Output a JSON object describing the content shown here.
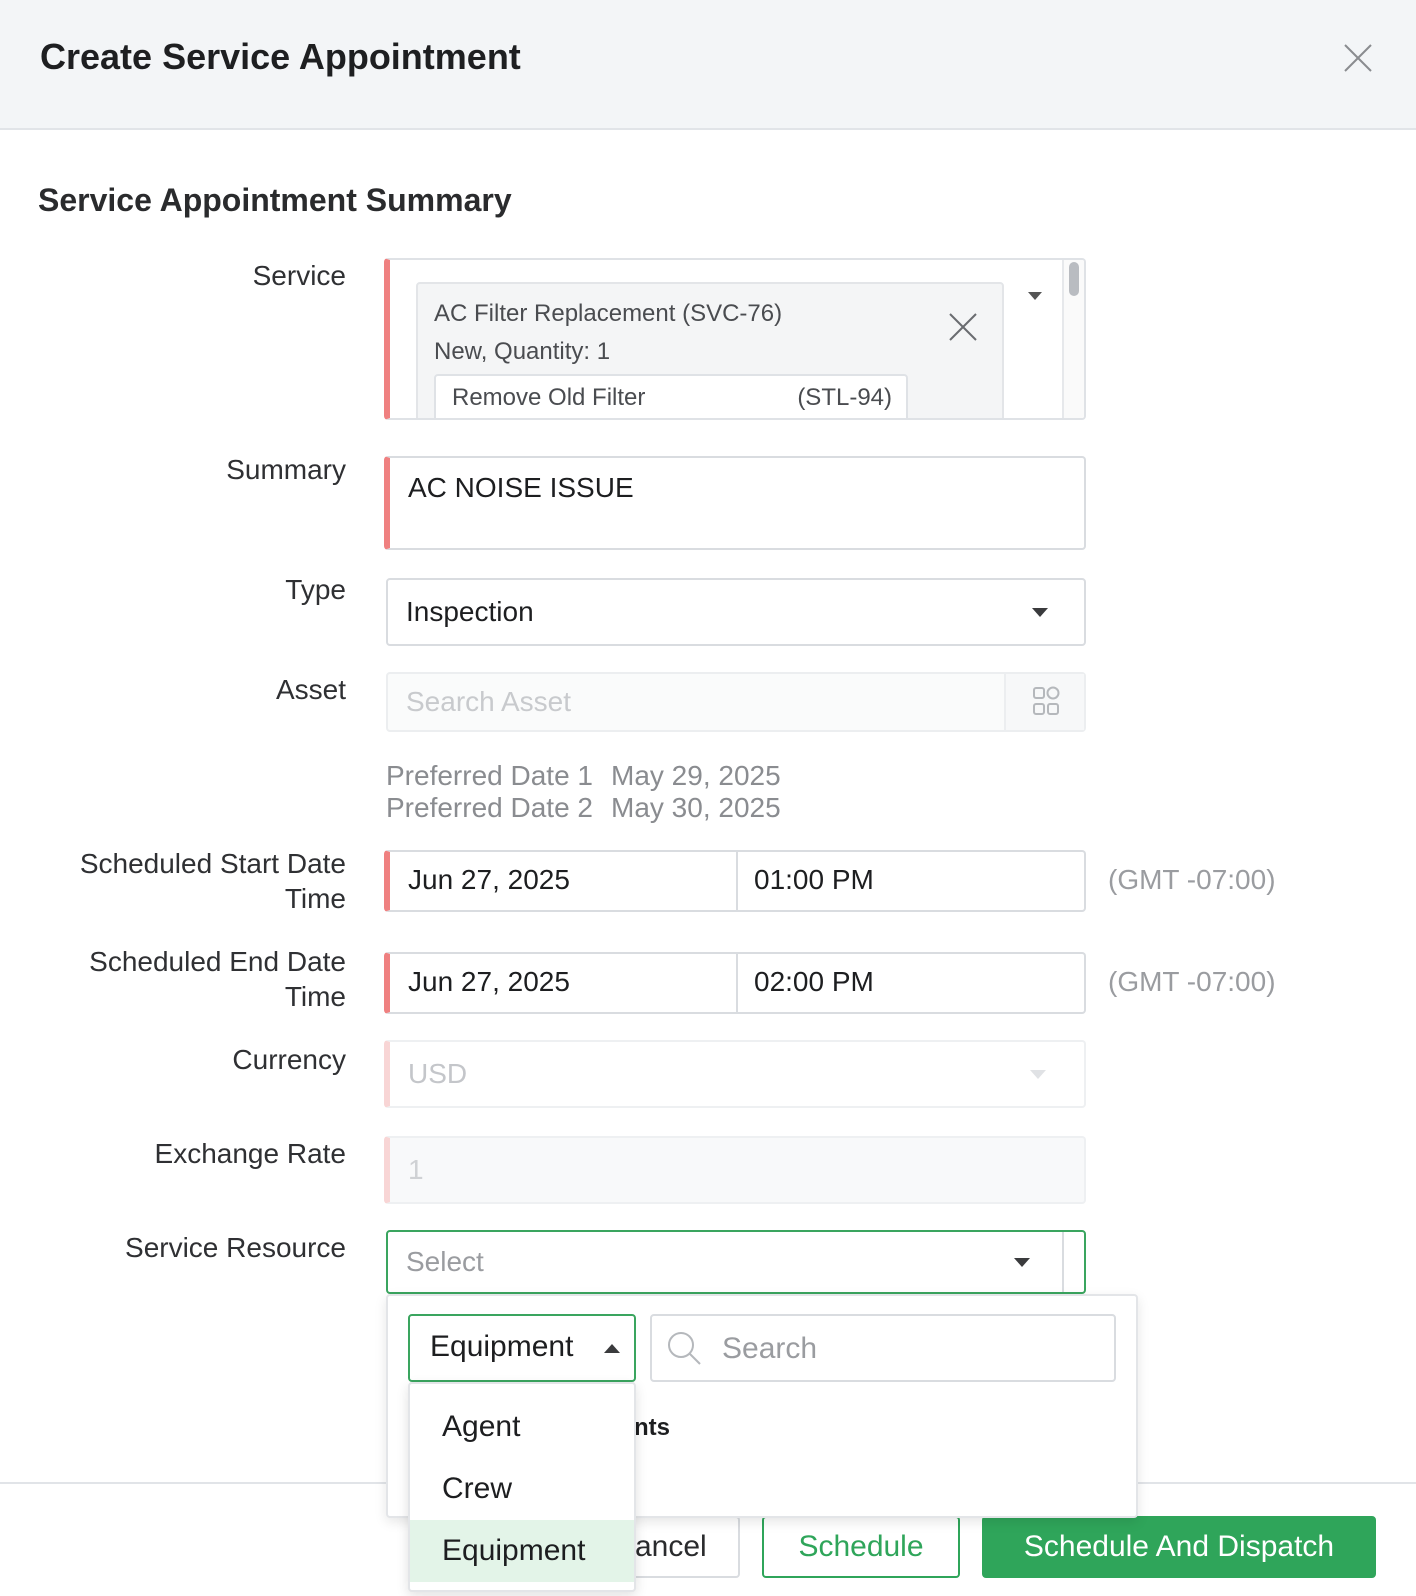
{
  "header": {
    "title": "Create Service Appointment"
  },
  "section_title": "Service Appointment Summary",
  "labels": {
    "service": "Service",
    "summary": "Summary",
    "type": "Type",
    "asset": "Asset",
    "scheduled_start": "Scheduled Start Date Time",
    "scheduled_end": "Scheduled End Date Time",
    "currency": "Currency",
    "exchange_rate": "Exchange Rate",
    "service_resource": "Service Resource"
  },
  "service": {
    "name": "AC Filter Replacement (SVC-76)",
    "detail": "New, Quantity: 1",
    "subtask_name": "Remove Old Filter",
    "subtask_code": "(STL-94)"
  },
  "summary_value": "AC NOISE ISSUE",
  "type_value": "Inspection",
  "asset_placeholder": "Search Asset",
  "preferred_dates": [
    {
      "label": "Preferred Date 1",
      "value": "May 29, 2025"
    },
    {
      "label": "Preferred Date 2",
      "value": "May 30, 2025"
    }
  ],
  "scheduled_start": {
    "date": "Jun 27, 2025",
    "time": "01:00 PM",
    "tz": "(GMT -07:00)"
  },
  "scheduled_end": {
    "date": "Jun 27, 2025",
    "time": "02:00 PM",
    "tz": "(GMT -07:00)"
  },
  "currency_value": "USD",
  "exchange_rate_value": "1",
  "service_resource_placeholder": "Select",
  "resource_panel": {
    "category_selected": "Equipment",
    "search_placeholder": "Search",
    "partial_text": "nts",
    "category_options": [
      "Agent",
      "Crew",
      "Equipment"
    ]
  },
  "footer": {
    "cancel_label": "Cancel",
    "schedule_label": "Schedule",
    "dispatch_label": "Schedule And Dispatch"
  },
  "colors": {
    "accent_green": "#2fa55a",
    "required_red": "#ef8080",
    "header_bg": "#f3f5f7"
  }
}
